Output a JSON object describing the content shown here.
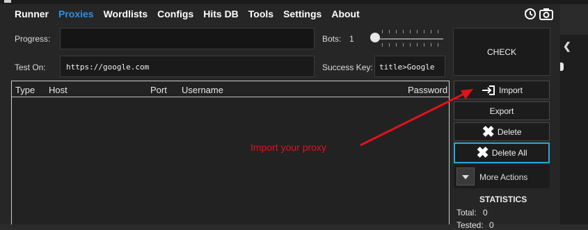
{
  "nav": {
    "items": [
      "Runner",
      "Proxies",
      "Wordlists",
      "Configs",
      "Hits DB",
      "Tools",
      "Settings",
      "About"
    ],
    "active": "Proxies",
    "icons": [
      "history-icon",
      "camera-icon"
    ]
  },
  "form": {
    "progress_label": "Progress:",
    "bots_label": "Bots:",
    "bots_value": "1",
    "test_on_label": "Test On:",
    "test_on_value": "https://google.com",
    "success_key_label": "Success Key:",
    "success_key_value": "title>Google"
  },
  "check_button": "CHECK",
  "table": {
    "columns": [
      "Type",
      "Host",
      "Port",
      "Username",
      "Password"
    ],
    "rows": []
  },
  "actions": {
    "import": "Import",
    "export": "Export",
    "delete": "Delete",
    "delete_all": "Delete All",
    "more_actions": "More Actions"
  },
  "statistics": {
    "title": "STATISTICS",
    "total_label": "Total:",
    "total_value": "0",
    "tested_label": "Tested:",
    "tested_value": "0"
  },
  "annotation": {
    "text": "Import your proxy",
    "color": "#e1121a"
  },
  "colors": {
    "accent": "#2f8fe6",
    "selected_border": "#2aa7d8"
  }
}
